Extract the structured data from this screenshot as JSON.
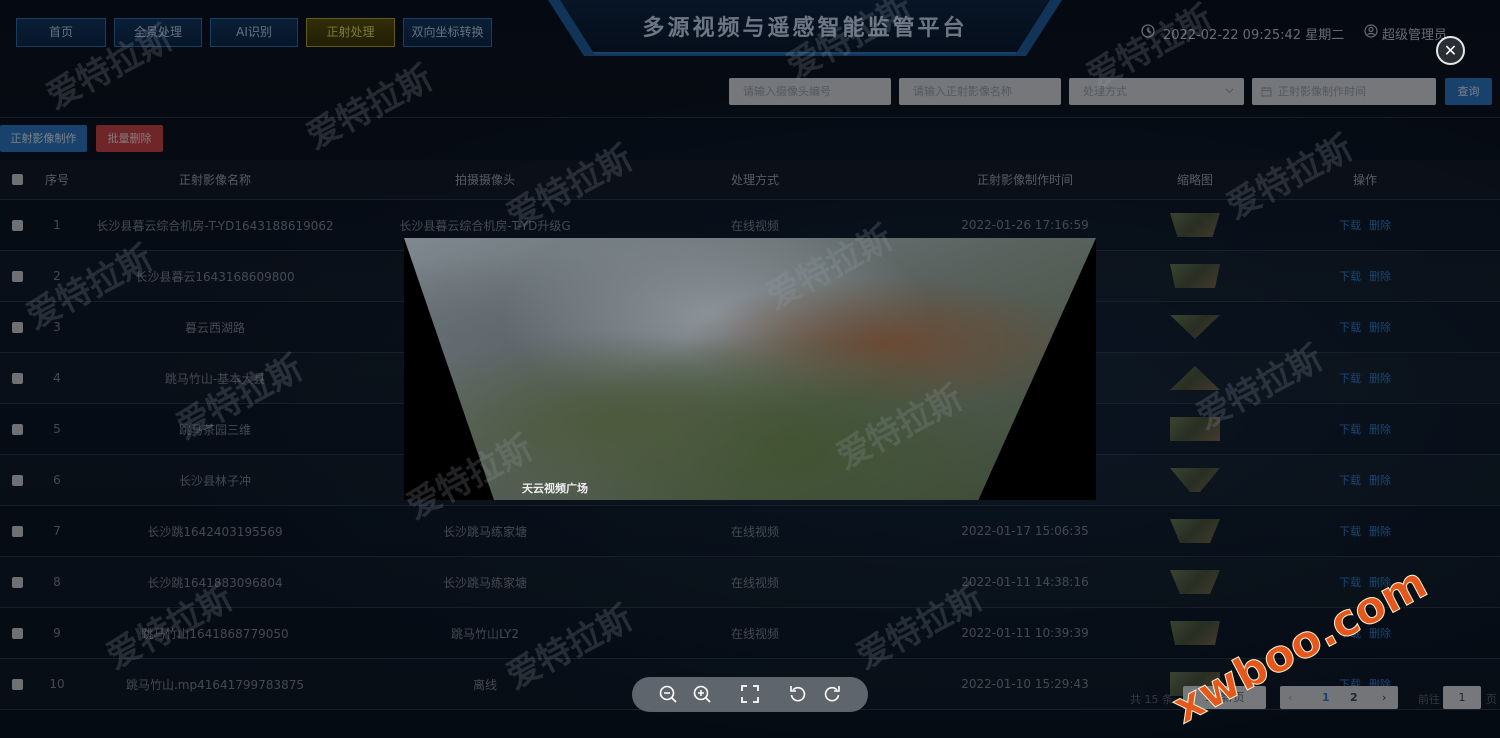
{
  "header": {
    "nav": [
      {
        "label": "首页",
        "active": false
      },
      {
        "label": "全景处理",
        "active": false
      },
      {
        "label": "AI识别",
        "active": false
      },
      {
        "label": "正射处理",
        "active": true
      },
      {
        "label": "双向坐标转换",
        "active": false
      }
    ],
    "title": "多源视频与遥感智能监管平台",
    "datetime": "2022-02-22 09:25:42 星期二",
    "user": "超级管理员"
  },
  "filters": {
    "camera_placeholder": "请输入摄像头编号",
    "image_name_placeholder": "请输入正射影像名称",
    "method_placeholder": "处理方式",
    "time_placeholder": "正射影像制作时间",
    "query_label": "查询"
  },
  "actions": {
    "create_label": "正射影像制作",
    "batch_delete_label": "批量删除"
  },
  "table": {
    "headers": [
      "序号",
      "正射影像名称",
      "拍摄摄像头",
      "处理方式",
      "正射影像制作时间",
      "缩略图",
      "操作"
    ],
    "rows": [
      {
        "no": "1",
        "name": "长沙县暮云综合机房-T-YD1643188619062",
        "camera": "长沙县暮云综合机房-T-YD升级G",
        "method": "在线视频",
        "time": "2022-01-26 17:16:59"
      },
      {
        "no": "2",
        "name": "长沙县暮云1643168609800",
        "camera": "",
        "method": "",
        "time": ""
      },
      {
        "no": "3",
        "name": "暮云西湖路",
        "camera": "",
        "method": "",
        "time": ""
      },
      {
        "no": "4",
        "name": "跳马竹山-基本大县",
        "camera": "",
        "method": "",
        "time": ""
      },
      {
        "no": "5",
        "name": "跳马茶园三维",
        "camera": "",
        "method": "",
        "time": ""
      },
      {
        "no": "6",
        "name": "长沙县林子冲",
        "camera": "",
        "method": "",
        "time": ""
      },
      {
        "no": "7",
        "name": "长沙跳1642403195569",
        "camera": "长沙跳马练家塘",
        "method": "在线视频",
        "time": "2022-01-17 15:06:35"
      },
      {
        "no": "8",
        "name": "长沙跳1641883096804",
        "camera": "长沙跳马练家塘",
        "method": "在线视频",
        "time": "2022-01-11 14:38:16"
      },
      {
        "no": "9",
        "name": "跳马竹山1641868779050",
        "camera": "跳马竹山LY2",
        "method": "在线视频",
        "time": "2022-01-11 10:39:39"
      },
      {
        "no": "10",
        "name": "跳马竹山.mp41641799783875",
        "camera": "离线",
        "method": "",
        "time": "2022-01-10 15:29:43"
      }
    ],
    "row_actions": {
      "download": "下载",
      "delete": "删除"
    }
  },
  "pagination": {
    "total": "共 15 条",
    "page_size": "10条/页",
    "pages": [
      "1",
      "2"
    ],
    "current_page": "1",
    "goto_label": "前往",
    "goto_value": "1",
    "unit": "页"
  },
  "preview": {
    "caption": "天云视频广场"
  },
  "watermarks": {
    "text": "爱特拉斯",
    "site": "xwboo.com"
  },
  "colors": {
    "accent_blue": "#2c79c5",
    "danger_red": "#c9454c",
    "active_nav": "#b5a22a"
  }
}
